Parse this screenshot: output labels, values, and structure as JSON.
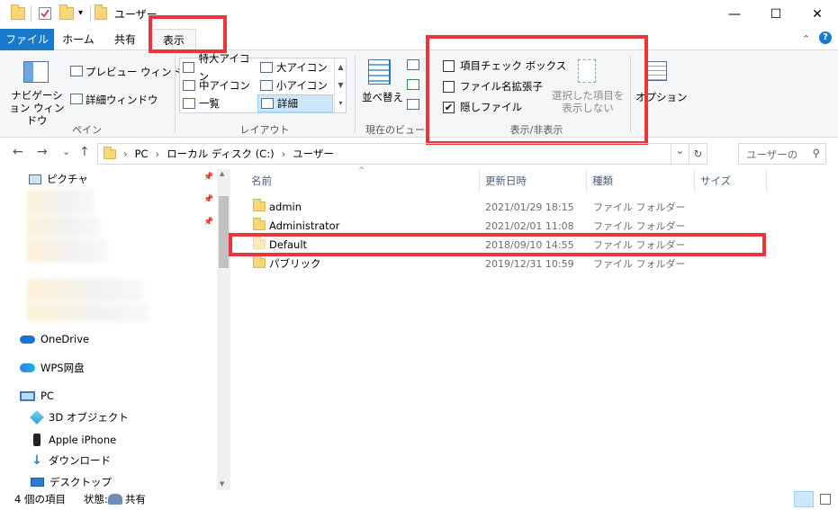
{
  "window": {
    "title": "ユーザー",
    "quick_access_dropdown": "▾",
    "controls": {
      "minimize": "—",
      "maximize": "☐",
      "close": "✕"
    }
  },
  "tabs": [
    {
      "label": "ファイル"
    },
    {
      "label": "ホーム"
    },
    {
      "label": "共有"
    },
    {
      "label": "表示"
    }
  ],
  "ribbon": {
    "pane_group": {
      "label": "ペイン",
      "navigation_pane": "ナビゲーション ウィンドウ",
      "preview_pane": "プレビュー ウィンドウ",
      "details_pane": "詳細ウィンドウ"
    },
    "layout_group": {
      "label": "レイアウト",
      "items": [
        {
          "label": "特大アイコン"
        },
        {
          "label": "大アイコン"
        },
        {
          "label": "中アイコン"
        },
        {
          "label": "小アイコン"
        },
        {
          "label": "一覧"
        },
        {
          "label": "詳細",
          "selected": true
        }
      ]
    },
    "current_view_group": {
      "label": "現在のビュー",
      "sort_by": "並べ替え"
    },
    "show_hide_group": {
      "label": "表示/非表示",
      "item_checkboxes": {
        "label": "項目チェック ボックス",
        "checked": false
      },
      "file_extensions": {
        "label": "ファイル名拡張子",
        "checked": false
      },
      "hidden_items": {
        "label": "隠しファイル",
        "checked": true
      },
      "hide_selected": "選択した項目を 表示しない",
      "check_mark": "✔"
    },
    "options": "オプション"
  },
  "address": {
    "back": "←",
    "forward": "→",
    "recent": "⌄",
    "up": "↑",
    "breadcrumb": [
      "PC",
      "ローカル ディスク (C:)",
      "ユーザー"
    ],
    "separator": "›",
    "dropdown": "⌄",
    "refresh": "↻",
    "search_placeholder": "ユーザーの",
    "search_icon": "⚲"
  },
  "nav_pane": {
    "pinned_marker": "📌",
    "items": [
      {
        "label": "ピクチャ",
        "icon": "pictures-icon"
      },
      {
        "label": "OneDrive",
        "icon": "onedrive-icon"
      },
      {
        "label": "WPS网盘",
        "icon": "wps-cloud-icon"
      },
      {
        "label": "PC",
        "icon": "pc-icon"
      },
      {
        "label": "3D オブジェクト",
        "icon": "3d-objects-icon"
      },
      {
        "label": "Apple iPhone",
        "icon": "phone-icon"
      },
      {
        "label": "ダウンロード",
        "icon": "download-icon"
      },
      {
        "label": "デスクトップ",
        "icon": "desktop-icon"
      }
    ]
  },
  "file_list": {
    "sort_indicator": "^",
    "columns": [
      "名前",
      "更新日時",
      "種類",
      "サイズ"
    ],
    "rows": [
      {
        "name": "admin",
        "modified": "2021/01/29 18:15",
        "type": "ファイル フォルダー"
      },
      {
        "name": "Administrator",
        "modified": "2021/02/01 11:08",
        "type": "ファイル フォルダー"
      },
      {
        "name": "Default",
        "modified": "2018/09/10 14:55",
        "type": "ファイル フォルダー"
      },
      {
        "name": "パブリック",
        "modified": "2019/12/31 10:59",
        "type": "ファイル フォルダー"
      }
    ]
  },
  "status_bar": {
    "item_count": "4 個の項目",
    "state_label": "状態:",
    "state_value": "共有"
  },
  "colors": {
    "accent": "#1979ca",
    "annotation_red": "#e8363a",
    "folder": "#f8d775"
  }
}
